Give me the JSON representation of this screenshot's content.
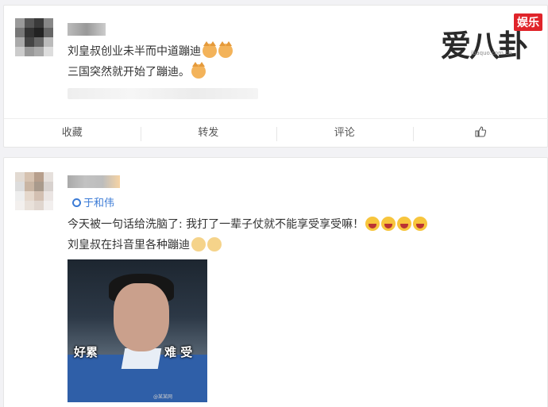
{
  "logo": {
    "main": "爱八卦",
    "badge": "娱乐",
    "url": "ibaquo.com.cn"
  },
  "post1": {
    "line1": "刘皇叔创业未半而中道蹦迪",
    "line2": "三国突然就开始了蹦迪。",
    "actions": {
      "collect": "收藏",
      "repost": "转发",
      "comment": "评论",
      "like_icon": "thumbs-up-icon"
    }
  },
  "post2": {
    "mention": "于和伟",
    "line1": "今天被一句话给洗脑了: 我打了一辈子仗就不能享受享受嘛！",
    "line2": "刘皇叔在抖音里各种蹦迪",
    "image": {
      "caption_left": "好累",
      "caption_right": "难 受",
      "watermark": "@某某网"
    }
  },
  "colors": {
    "link": "#3b7bd6",
    "badge": "#e0242a"
  }
}
